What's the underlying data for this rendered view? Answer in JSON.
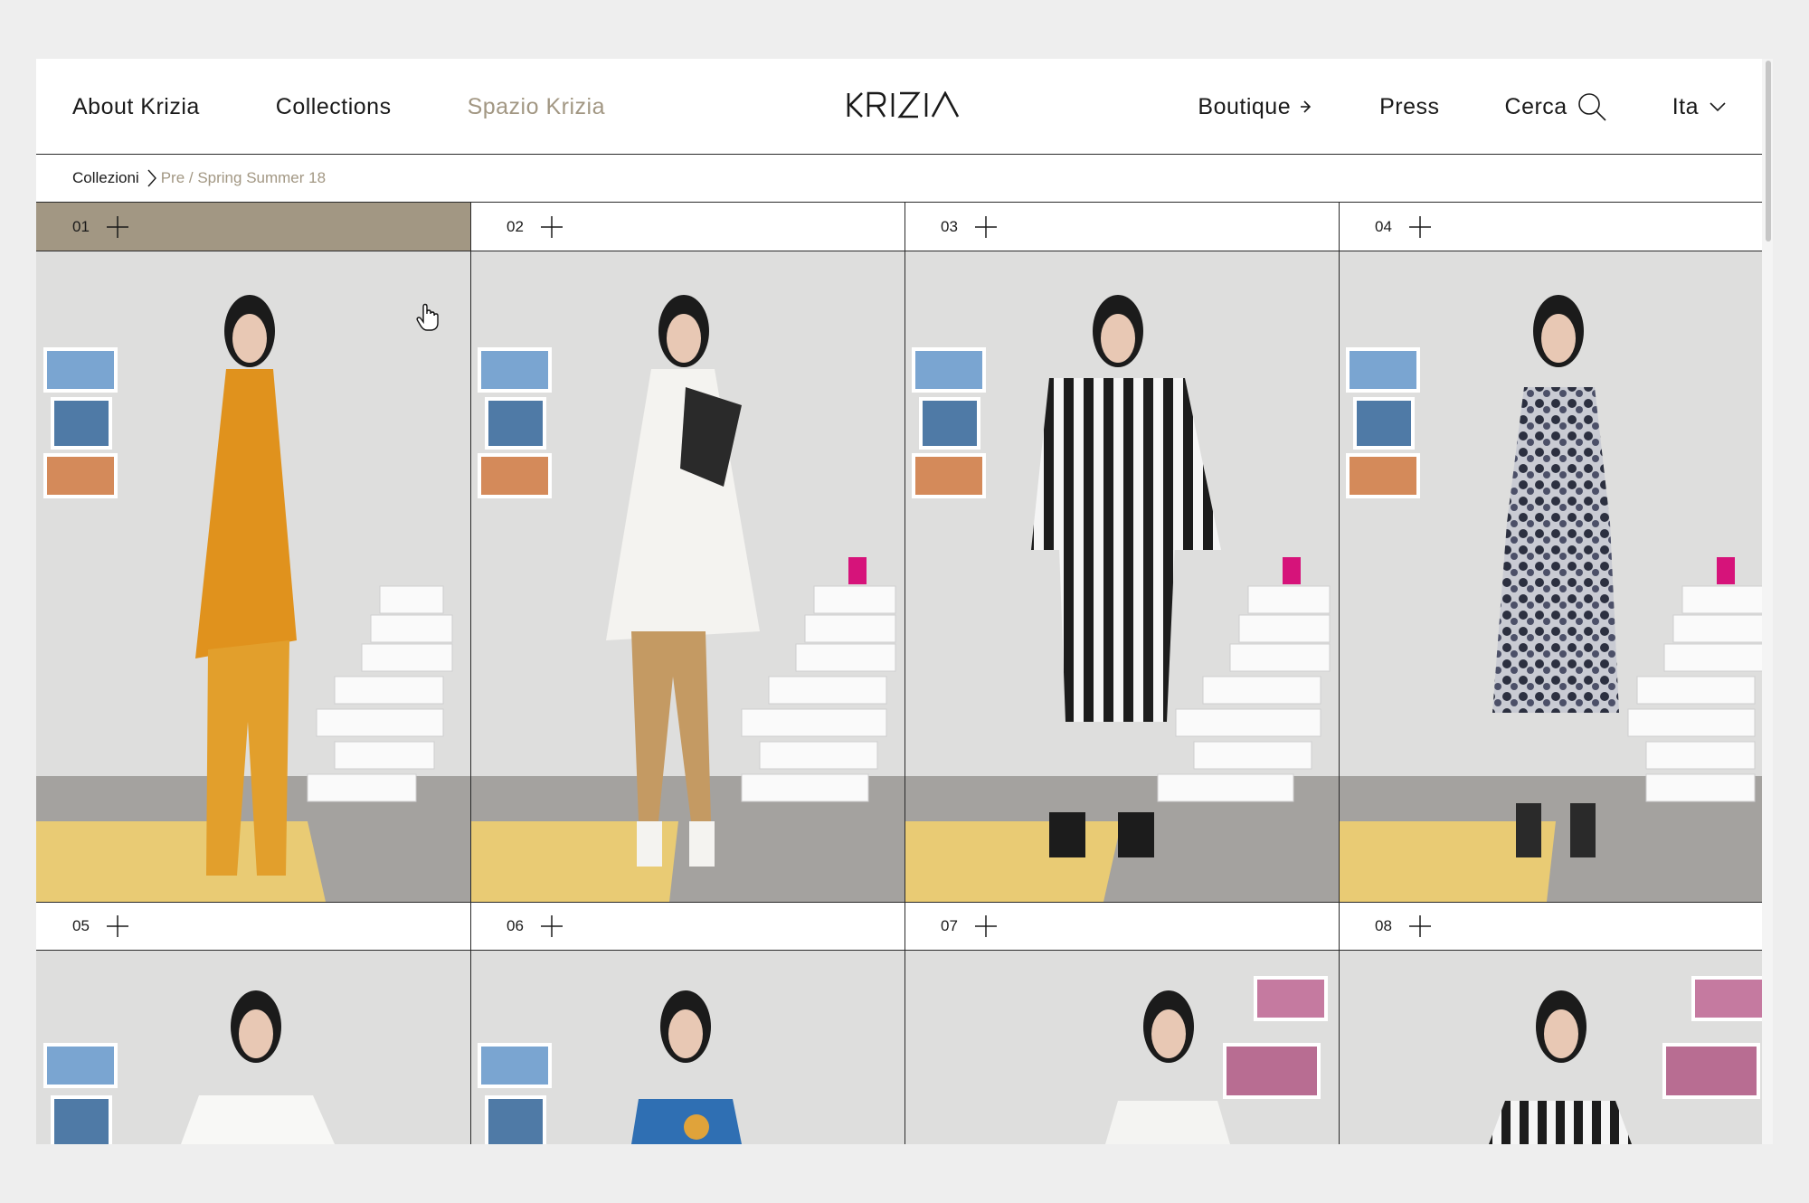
{
  "nav": {
    "left": [
      {
        "label": "About Krizia"
      },
      {
        "label": "Collections"
      },
      {
        "label": "Spazio Krizia"
      }
    ],
    "logo_text": "KRIZIA",
    "right": {
      "boutique": "Boutique",
      "press": "Press",
      "search": "Cerca",
      "language": "Ita"
    }
  },
  "breadcrumb": {
    "root": "Collezioni",
    "current": "Pre / Spring Summer 18"
  },
  "looks": [
    {
      "number": "01",
      "selected": true,
      "outfit": "orange pleated tunic and wide trousers",
      "color": "#e0921d"
    },
    {
      "number": "02",
      "selected": false,
      "outfit": "white shirt with embroidered patch and tan trousers",
      "color": "#f2f0ec"
    },
    {
      "number": "03",
      "selected": false,
      "outfit": "black and white striped top and skirt",
      "color": "#222222"
    },
    {
      "number": "04",
      "selected": false,
      "outfit": "sequin floral dress",
      "color": "#3a3d4a"
    },
    {
      "number": "05",
      "selected": false,
      "outfit": "white shirt",
      "color": "#f6f6f4"
    },
    {
      "number": "06",
      "selected": false,
      "outfit": "blue printed top",
      "color": "#2f6fb3"
    },
    {
      "number": "07",
      "selected": false,
      "outfit": "white trench",
      "color": "#f3f3f1"
    },
    {
      "number": "08",
      "selected": false,
      "outfit": "striped shirt",
      "color": "#1f1f1f"
    }
  ],
  "colors": {
    "accent": "#a29783",
    "background": "#eeeeee",
    "photo_wall": "#dcdcdb",
    "floor": "#9c9a97",
    "yellow_mat": "#e9cb74"
  }
}
